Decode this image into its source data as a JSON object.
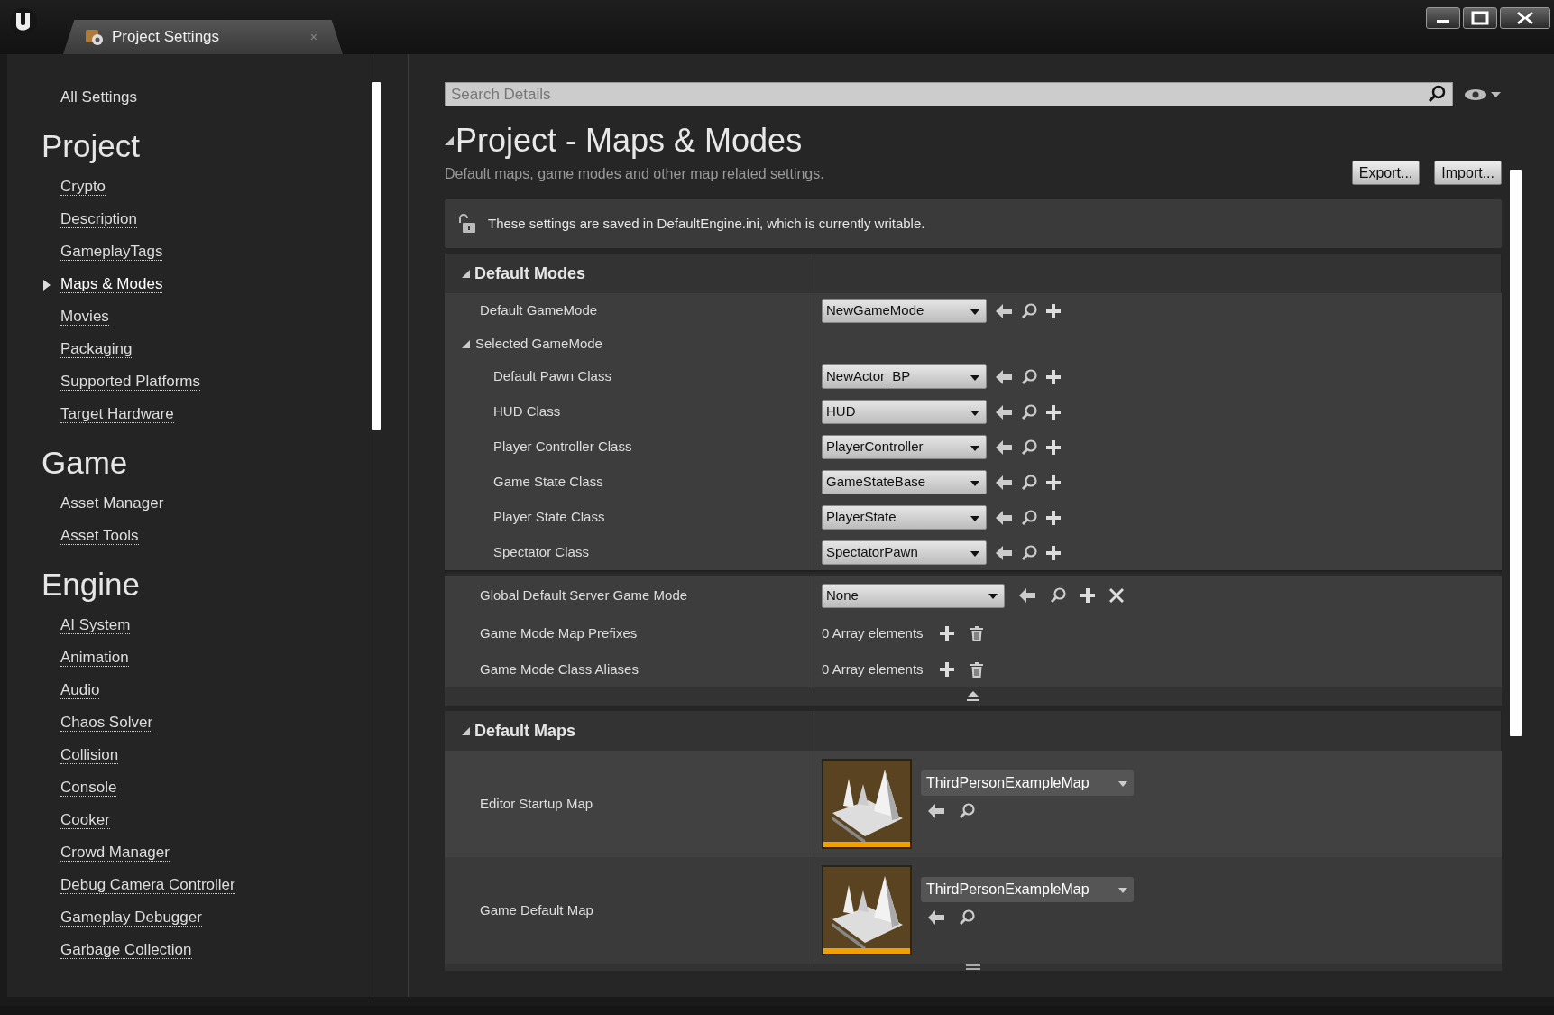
{
  "window": {
    "tab_title": "Project Settings",
    "tab_close": "×"
  },
  "sidebar": {
    "top_link": "All Settings",
    "sections": [
      {
        "heading": "Project",
        "items": [
          {
            "label": "Crypto",
            "selected": false
          },
          {
            "label": "Description",
            "selected": false
          },
          {
            "label": "GameplayTags",
            "selected": false
          },
          {
            "label": "Maps & Modes",
            "selected": true
          },
          {
            "label": "Movies",
            "selected": false
          },
          {
            "label": "Packaging",
            "selected": false
          },
          {
            "label": "Supported Platforms",
            "selected": false
          },
          {
            "label": "Target Hardware",
            "selected": false
          }
        ]
      },
      {
        "heading": "Game",
        "items": [
          {
            "label": "Asset Manager",
            "selected": false
          },
          {
            "label": "Asset Tools",
            "selected": false
          }
        ]
      },
      {
        "heading": "Engine",
        "items": [
          {
            "label": "AI System",
            "selected": false
          },
          {
            "label": "Animation",
            "selected": false
          },
          {
            "label": "Audio",
            "selected": false
          },
          {
            "label": "Chaos Solver",
            "selected": false
          },
          {
            "label": "Collision",
            "selected": false
          },
          {
            "label": "Console",
            "selected": false
          },
          {
            "label": "Cooker",
            "selected": false
          },
          {
            "label": "Crowd Manager",
            "selected": false
          },
          {
            "label": "Debug Camera Controller",
            "selected": false
          },
          {
            "label": "Gameplay Debugger",
            "selected": false
          },
          {
            "label": "Garbage Collection",
            "selected": false
          }
        ]
      }
    ]
  },
  "search": {
    "placeholder": "Search Details"
  },
  "page": {
    "title": "Project - Maps & Modes",
    "description": "Default maps, game modes and other map related settings.",
    "buttons": [
      "Export...",
      "Import..."
    ],
    "notice": "These settings are saved in DefaultEngine.ini, which is currently writable."
  },
  "categories": [
    {
      "title": "Default Modes",
      "expanded": true,
      "properties": [
        {
          "kind": "class",
          "label": "Default GameMode",
          "value": "NewGameMode",
          "clear": false
        },
        {
          "kind": "group",
          "label": "Selected GameMode",
          "expanded": true,
          "children": [
            {
              "kind": "class",
              "label": "Default Pawn Class",
              "value": "NewActor_BP",
              "clear": false
            },
            {
              "kind": "class",
              "label": "HUD Class",
              "value": "HUD",
              "clear": false
            },
            {
              "kind": "class",
              "label": "Player Controller Class",
              "value": "PlayerController",
              "clear": false
            },
            {
              "kind": "class",
              "label": "Game State Class",
              "value": "GameStateBase",
              "clear": false
            },
            {
              "kind": "class",
              "label": "Player State Class",
              "value": "PlayerState",
              "clear": false
            },
            {
              "kind": "class",
              "label": "Spectator Class",
              "value": "SpectatorPawn",
              "clear": false
            }
          ]
        },
        {
          "kind": "class",
          "label": "Global Default Server Game Mode",
          "value": "None",
          "clear": true
        },
        {
          "kind": "array",
          "label": "Game Mode Map Prefixes",
          "value": "0 Array elements"
        },
        {
          "kind": "array",
          "label": "Game Mode Class Aliases",
          "value": "0 Array elements"
        }
      ]
    },
    {
      "title": "Default Maps",
      "expanded": true,
      "properties": [
        {
          "kind": "map",
          "label": "Editor Startup Map",
          "value": "ThirdPersonExampleMap"
        },
        {
          "kind": "map",
          "label": "Game Default Map",
          "value": "ThirdPersonExampleMap"
        }
      ]
    }
  ]
}
